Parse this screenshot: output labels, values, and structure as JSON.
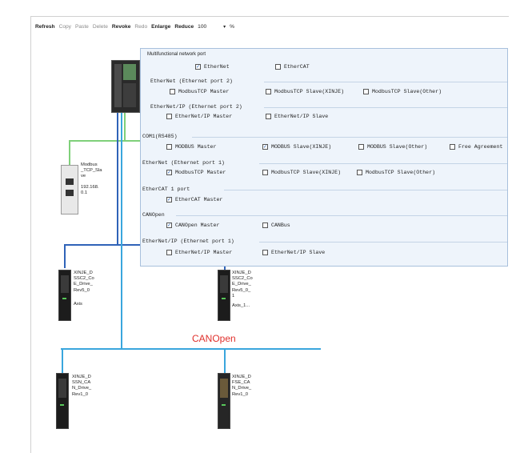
{
  "toolbar": {
    "refresh": "Refresh",
    "copy": "Copy",
    "paste": "Paste",
    "delete": "Delete",
    "revoke": "Revoke",
    "redo": "Redo",
    "enlarge": "Enlarge",
    "reduce": "Reduce",
    "zoom_value": "100",
    "zoom_unit": "%"
  },
  "panel": {
    "header": "Multifunctional network port",
    "top_options": [
      {
        "label": "EtherNet",
        "checked": true
      },
      {
        "label": "EtherCAT",
        "checked": false
      }
    ],
    "groups": [
      {
        "title": "EtherNet (Ethernet port 2)",
        "options": [
          {
            "label": "ModbusTCP Master",
            "checked": false
          },
          {
            "label": "ModbusTCP Slave(XINJE)",
            "checked": false
          },
          {
            "label": "ModbusTCP Slave(Other)",
            "checked": false
          }
        ]
      },
      {
        "title": "EtherNet/IP (Ethernet port 2)",
        "options": [
          {
            "label": "EtherNet/IP Master",
            "checked": false
          },
          {
            "label": "EtherNet/IP Slave",
            "checked": false
          }
        ]
      },
      {
        "title": "COM1(RS485)",
        "options": [
          {
            "label": "MODBUS Master",
            "checked": false
          },
          {
            "label": "MODBUS Slave(XINJE)",
            "checked": true
          },
          {
            "label": "MODBUS Slave(Other)",
            "checked": false
          },
          {
            "label": "Free Agreement",
            "checked": false
          }
        ]
      },
      {
        "title": "EtherNet (Ethernet port 1)",
        "options": [
          {
            "label": "ModbusTCP Master",
            "checked": true
          },
          {
            "label": "ModbusTCP Slave(XINJE)",
            "checked": false
          },
          {
            "label": "ModbusTCP Slave(Other)",
            "checked": false
          }
        ]
      },
      {
        "title": "EtherCAT 1 port",
        "options": [
          {
            "label": "EtherCAT Master",
            "checked": true
          }
        ]
      },
      {
        "title": "CANOpen",
        "options": [
          {
            "label": "CANOpen Master",
            "checked": true
          },
          {
            "label": "CANBus",
            "checked": false
          }
        ]
      },
      {
        "title": "EtherNet/IP (Ethernet port 1)",
        "options": [
          {
            "label": "EtherNet/IP Master",
            "checked": false
          },
          {
            "label": "EtherNet/IP Slave",
            "checked": false
          }
        ]
      }
    ]
  },
  "devices": {
    "modbus_slave": {
      "name_lines": [
        "Modbus",
        "_TCP_Sla",
        "ve"
      ],
      "ip_lines": [
        "192.168.",
        "0.1"
      ]
    },
    "drive1": {
      "lines": [
        "XINJE_D",
        "SSC2_Co",
        "E_Drive_",
        "Rev5_0"
      ],
      "axis": "Axis"
    },
    "drive2": {
      "lines": [
        "XINJE_D",
        "SSC2_Co",
        "E_Drive_",
        "Rev5_0_",
        "1"
      ],
      "axis": "Axis_1..."
    },
    "drive3": {
      "lines": [
        "XINJE_D",
        "SSN_CA",
        "N_Drive_",
        "Rev1_0"
      ]
    },
    "drive4": {
      "lines": [
        "XINJE_D",
        "FSE_CA",
        "N_Drive_",
        "Rev1_0"
      ]
    }
  },
  "canopen_label": "CANOpen",
  "colors": {
    "ethernet": "#7fd07a",
    "ethercat": "#2f63b8",
    "canopen": "#3aa6dd",
    "canopen_text": "#e0302c",
    "panel_bg": "#eef4fb"
  }
}
